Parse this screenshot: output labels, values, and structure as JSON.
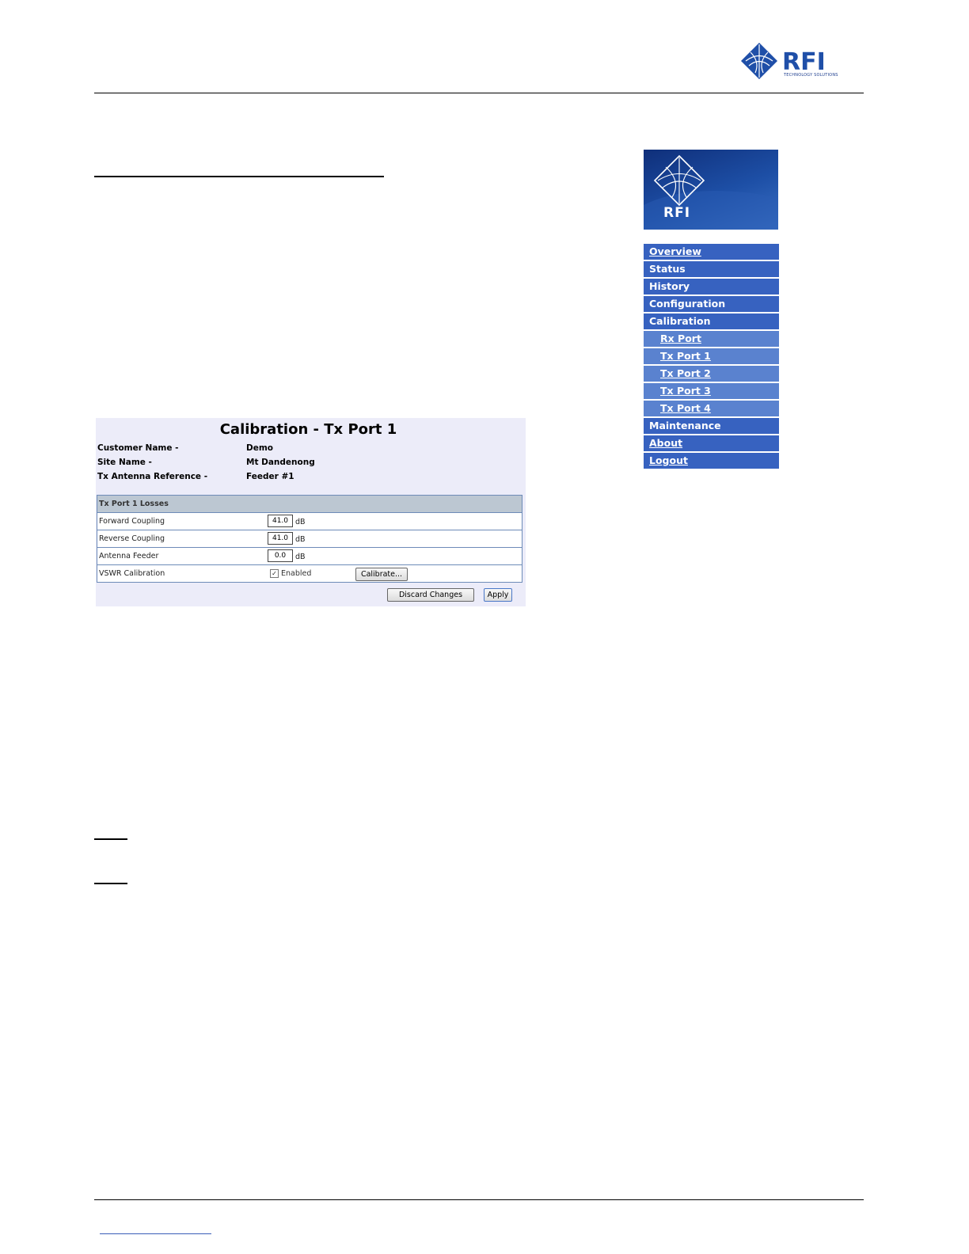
{
  "header": {
    "logo_text": "RFI",
    "logo_subtext": "TECHNOLOGY SOLUTIONS"
  },
  "sidebar": {
    "logo_text": "RFI",
    "nav": [
      {
        "label": "Overview",
        "link": true,
        "sub": false
      },
      {
        "label": "Status",
        "link": false,
        "sub": false
      },
      {
        "label": "History",
        "link": false,
        "sub": false
      },
      {
        "label": "Configuration",
        "link": false,
        "sub": false
      },
      {
        "label": "Calibration",
        "link": false,
        "sub": false
      },
      {
        "label": "Rx Port",
        "link": true,
        "sub": true
      },
      {
        "label": "Tx Port 1",
        "link": true,
        "sub": true
      },
      {
        "label": "Tx Port 2",
        "link": true,
        "sub": true
      },
      {
        "label": "Tx Port 3",
        "link": true,
        "sub": true
      },
      {
        "label": "Tx Port 4",
        "link": true,
        "sub": true
      },
      {
        "label": "Maintenance",
        "link": false,
        "sub": false
      },
      {
        "label": "About",
        "link": true,
        "sub": false
      },
      {
        "label": "Logout",
        "link": true,
        "sub": false
      }
    ]
  },
  "panel": {
    "title": "Calibration - Tx Port 1",
    "info": [
      {
        "label": "Customer Name -",
        "value": "Demo"
      },
      {
        "label": "Site Name -",
        "value": "Mt Dandenong"
      },
      {
        "label": "Tx Antenna Reference -",
        "value": "Feeder #1"
      }
    ],
    "losses_header": "Tx Port 1 Losses",
    "losses": [
      {
        "label": "Forward Coupling",
        "value": "41.0",
        "unit": "dB"
      },
      {
        "label": "Reverse Coupling",
        "value": "41.0",
        "unit": "dB"
      },
      {
        "label": "Antenna Feeder",
        "value": "0.0",
        "unit": "dB"
      }
    ],
    "vswr": {
      "label": "VSWR Calibration",
      "checkbox_mark": "✓",
      "enabled_label": "Enabled",
      "button_label": "Calibrate..."
    },
    "discard_label": "Discard Changes",
    "apply_label": "Apply"
  }
}
